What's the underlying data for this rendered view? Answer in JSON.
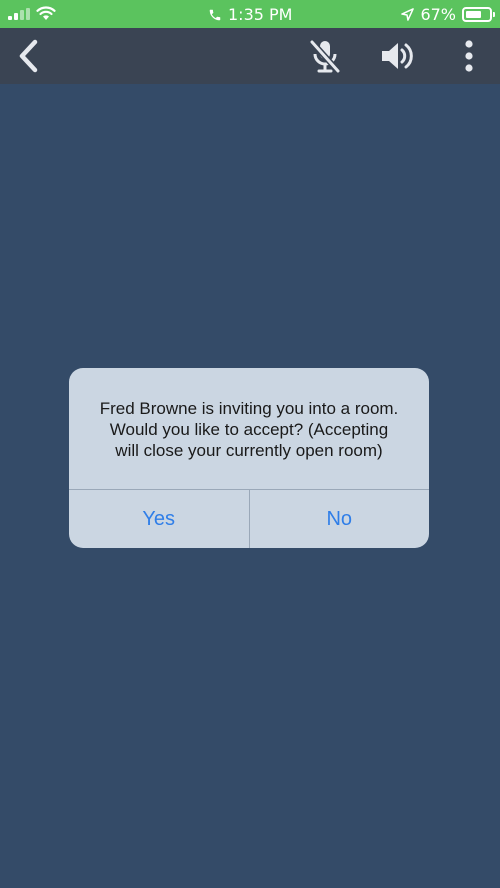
{
  "status_bar": {
    "time": "1:35 PM",
    "battery_text": "67%",
    "battery_level": 0.67
  },
  "toolbar": {
    "icons": [
      "chevron-left-icon",
      "mic-off-icon",
      "speaker-icon",
      "more-vertical-icon"
    ]
  },
  "dialog": {
    "message": "Fred Browne is inviting you into a room.\nWould you like to accept? (Accepting\nwill close your currently open room)",
    "yes_label": "Yes",
    "no_label": "No"
  },
  "colors": {
    "status_bar": "#5bc35e",
    "toolbar": "#3a4453",
    "background": "#344b68",
    "dialog": "#cbd6e2",
    "button_text": "#2f7ee8"
  }
}
